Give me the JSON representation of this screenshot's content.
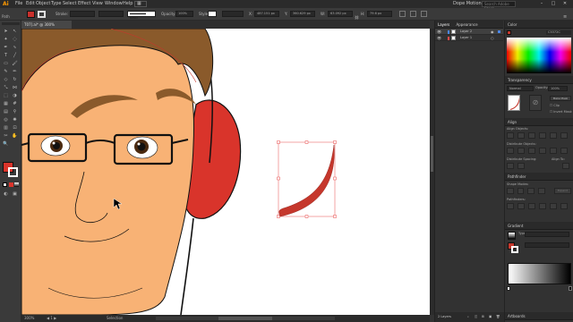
{
  "menu": {
    "logo": "Ai",
    "items": [
      "File",
      "Edit",
      "Object",
      "Type",
      "Select",
      "Effect",
      "View",
      "Window",
      "Help"
    ],
    "workspace": "Dope Motions",
    "search_placeholder": "Search Adobe Stock"
  },
  "control_bar": {
    "stroke_label": "Stroke:",
    "brush_label": "Basic",
    "opacity_label": "Opacity:",
    "opacity_value": "100%",
    "style_label": "Style:",
    "x_label": "X:",
    "x_value": "487.151 px",
    "y_label": "Y:",
    "y_value": "360.629 px",
    "w_label": "W:",
    "w_value": "63.092 px",
    "h_label": "H:",
    "h_value": "79.6 px"
  },
  "document": {
    "tab_title": "T07].ai* @ 300% (RGB/Preview)"
  },
  "status_bar": {
    "zoom": "300%",
    "tool": "Selection"
  },
  "layers_panel": {
    "tabs": [
      "Layers",
      "Appearance"
    ],
    "layers": [
      {
        "name": "Layer 2",
        "selected": true,
        "color": "#4a86e8"
      },
      {
        "name": "Layer 1",
        "selected": false,
        "color": "#e84a4a"
      }
    ],
    "footer": "2 Layers"
  },
  "right_panel": {
    "color_title": "Color",
    "hex_value": "C5372C",
    "transparency_title": "Transparency",
    "blend_mode": "Normal",
    "opacity_label": "Opacity:",
    "opacity_value": "100%",
    "make_mask_label": "Make Mask",
    "clip_label": "Clip",
    "invert_label": "Invert Mask",
    "align_title": "Align",
    "align_objects": "Align Objects:",
    "distribute_objects": "Distribute Objects:",
    "distribute_spacing": "Distribute Spacing:",
    "align_to": "Align To:",
    "pathfinder_title": "Pathfinder",
    "shape_modes": "Shape Modes:",
    "pathfinders": "Pathfinders:",
    "expand_label": "Expand",
    "gradient_title": "Gradient",
    "gradient_type_label": "Type:",
    "artboards_title": "Artboards"
  },
  "colors": {
    "accent": "#c5372c",
    "skin": "#f8b275",
    "hair": "#8a5a2b",
    "headphone": "#d9342b"
  }
}
